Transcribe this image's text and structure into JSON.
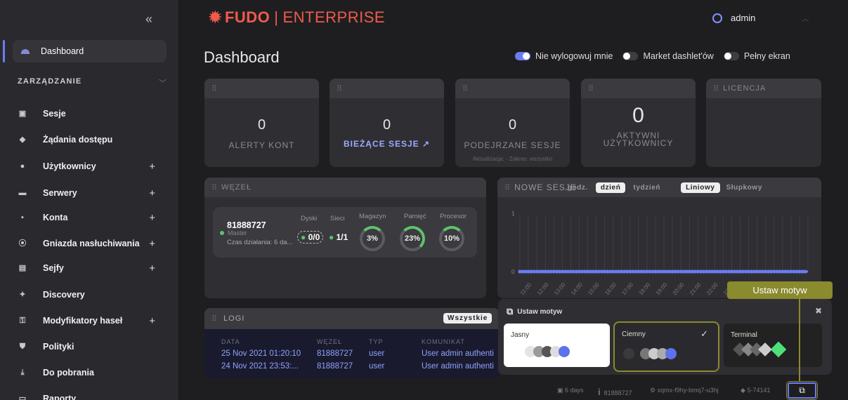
{
  "sidebar": {
    "collapse_icon": "double-chevron-left-icon",
    "dashboard": "Dashboard",
    "section": "ZARZĄDZANIE",
    "items": [
      {
        "label": "Sesje",
        "icon": "camera-icon",
        "plus": ""
      },
      {
        "label": "Żądania dostępu",
        "icon": "car-icon",
        "plus": ""
      },
      {
        "label": "Użytkownicy",
        "icon": "users-icon",
        "plus": "+"
      },
      {
        "label": "Serwery",
        "icon": "server-icon",
        "plus": "+"
      },
      {
        "label": "Konta",
        "icon": "account-icon",
        "plus": "+"
      },
      {
        "label": "Gniazda nasłuchiwania",
        "icon": "broadcast-icon",
        "plus": "+"
      },
      {
        "label": "Sejfy",
        "icon": "safe-icon",
        "plus": "+"
      },
      {
        "label": "Discovery",
        "icon": "wand-icon",
        "plus": ""
      },
      {
        "label": "Modyfikatory haseł",
        "icon": "key-icon",
        "plus": "+"
      },
      {
        "label": "Polityki",
        "icon": "shield-icon",
        "plus": ""
      },
      {
        "label": "Do pobrania",
        "icon": "download-icon",
        "plus": ""
      },
      {
        "label": "Raporty",
        "icon": "report-icon",
        "plus": ""
      }
    ]
  },
  "header": {
    "logo_fudo": "FUDO",
    "logo_sep": "|",
    "logo_enterprise": "ENTERPRISE",
    "user": "admin",
    "title": "Dashboard"
  },
  "toggles": [
    {
      "label": "Nie wylogowuj mnie",
      "on": true
    },
    {
      "label": "Market dashlet'ów",
      "on": false
    },
    {
      "label": "Pełny ekran",
      "on": false
    }
  ],
  "stats": [
    {
      "value": "0",
      "label": "ALERTY KONT"
    },
    {
      "value": "0",
      "label": "BIEŻĄCE SESJE ↗"
    },
    {
      "value": "0",
      "label": "PODEJRZANE SESJE",
      "sub": "Aktualizacja: -   Zakres: wszystko"
    },
    {
      "value": "0",
      "label": "AKTYWNI UŻYTKOWNICY"
    }
  ],
  "licencja": "LICENCJA",
  "node": {
    "header": "WĘZEŁ",
    "id": "81888727",
    "role": "Master",
    "uptime": "Czas działania: 6 da...",
    "disks_label": "Dyski",
    "disks": "0/0",
    "net_label": "Sieci",
    "net": "1/1",
    "storage_label": "Magazyn",
    "storage": "3%",
    "mem_label": "Pamięć",
    "mem": "23%",
    "cpu_label": "Procesor",
    "cpu": "10%"
  },
  "sessions_chart": {
    "header": "NOWE SESJE",
    "ranges": [
      "godz.",
      "dzień",
      "tydzień"
    ],
    "selected_range": "dzień",
    "types": [
      "Liniowy",
      "Słupkowy"
    ],
    "selected_type": "Liniowy"
  },
  "chart_data": {
    "type": "line",
    "x": [
      "11:00",
      "12:00",
      "13:00",
      "14:00",
      "15:00",
      "16:00",
      "17:00",
      "18:00",
      "19:00",
      "20:00",
      "21:00",
      "22:00",
      "23:00",
      "00:00",
      "01:00",
      "02:00",
      "03:00",
      "04:00"
    ],
    "series": [
      {
        "values": [
          0,
          0,
          0,
          0,
          0,
          0,
          0,
          0,
          0,
          0,
          0,
          0,
          0,
          0,
          0,
          0,
          0,
          0
        ]
      }
    ],
    "yticks": [
      "1",
      "0"
    ],
    "ylim": [
      0,
      1
    ],
    "color": "#6b7cf1"
  },
  "logs": {
    "header": "LOGI",
    "filter": "Wszystkie",
    "columns": [
      "DATA",
      "WĘZEŁ",
      "TYP",
      "KOMUNIKAT"
    ],
    "rows": [
      [
        "25 Nov 2021 01:20:10",
        "81888727",
        "user",
        "User admin authenti"
      ],
      [
        "24 Nov 2021 23:53:...",
        "81888727",
        "user",
        "User admin authenti"
      ]
    ]
  },
  "theme": {
    "title": "Ustaw motyw",
    "options": [
      {
        "name": "Jasny",
        "selected": false
      },
      {
        "name": "Ciemny",
        "selected": true
      },
      {
        "name": "Terminal",
        "selected": false
      }
    ],
    "tooltip": "Ustaw motyw"
  },
  "status": {
    "days": "6 days",
    "node": "81888727",
    "host": "xqmx-f9hy-bmq7-u3hj",
    "version": "5-74141"
  }
}
